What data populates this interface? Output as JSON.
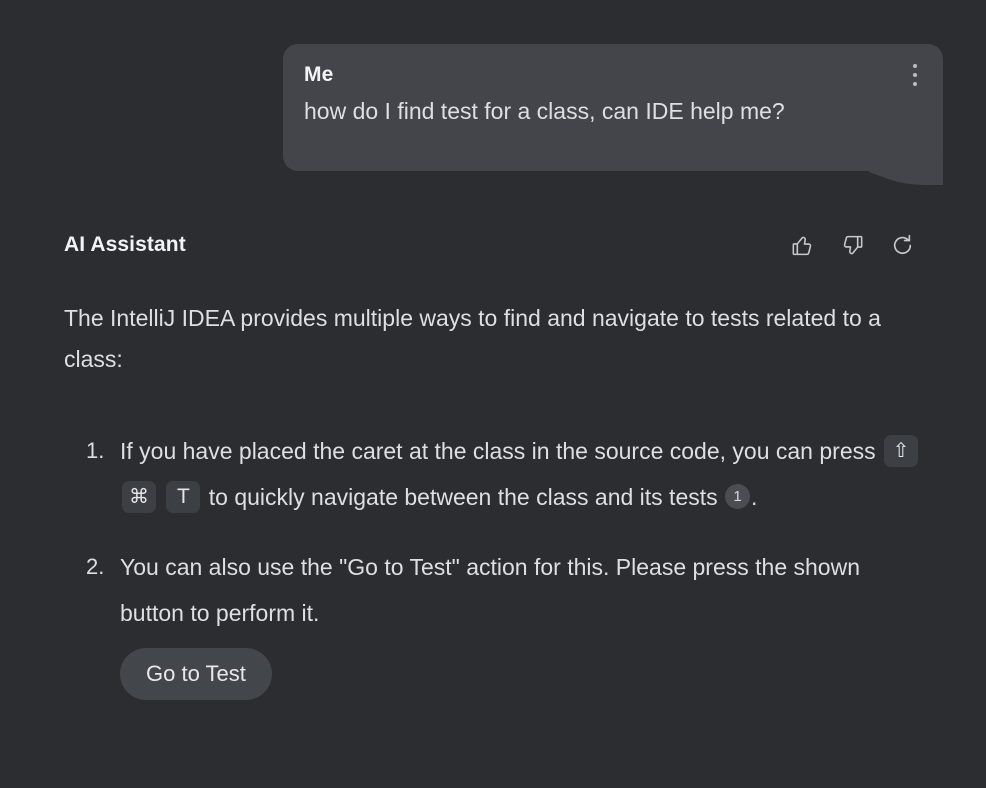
{
  "theme": {
    "background": "#2B2D30",
    "bubble_background": "#43454A",
    "keycap_background": "#3C3F43",
    "button_background": "#43464B",
    "badge_background": "#4A4D52",
    "text_primary": "#DDDFE3",
    "text_heading": "#F2F3F5"
  },
  "user_message": {
    "author": "Me",
    "text": "how do I find test for a class, can IDE help me?",
    "menu_icon": "more-vertical-icon"
  },
  "assistant": {
    "title": "AI Assistant",
    "actions": [
      {
        "name": "thumbs-up-icon",
        "label": "Like"
      },
      {
        "name": "thumbs-down-icon",
        "label": "Dislike"
      },
      {
        "name": "refresh-icon",
        "label": "Regenerate"
      }
    ],
    "intro": "The IntelliJ IDEA provides multiple ways to find and navigate to tests related to a class:",
    "list": [
      {
        "marker": "1.",
        "part1": "If you have placed the caret at the class in the source code, you can press",
        "keys": [
          "⇧",
          "⌘",
          "T"
        ],
        "part2": "to quickly navigate between the class and its tests",
        "citation": "1",
        "part3": "."
      },
      {
        "marker": "2.",
        "text": "You can also use the \"Go to Test\" action for this. Please press the shown button to perform it.",
        "button_label": "Go to Test"
      }
    ]
  }
}
